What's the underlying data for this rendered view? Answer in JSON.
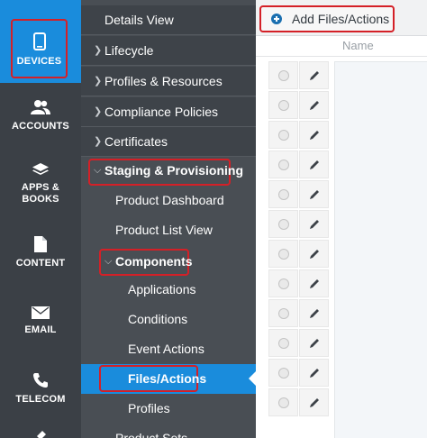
{
  "rail": {
    "items": [
      {
        "label": "DEVICES",
        "icon": "phone-icon"
      },
      {
        "label": "ACCOUNTS",
        "icon": "users-icon"
      },
      {
        "label_line1": "APPS &",
        "label_line2": "BOOKS",
        "icon": "layers-icon"
      },
      {
        "label": "CONTENT",
        "icon": "document-icon"
      },
      {
        "label": "EMAIL",
        "icon": "envelope-icon"
      },
      {
        "label": "TELECOM",
        "icon": "telephone-icon"
      }
    ],
    "active": "DEVICES"
  },
  "submenu": {
    "details_view": "Details View",
    "lifecycle": "Lifecycle",
    "profiles_resources": "Profiles & Resources",
    "compliance_policies": "Compliance Policies",
    "certificates": "Certificates",
    "staging_provisioning": "Staging & Provisioning",
    "product_dashboard": "Product Dashboard",
    "product_list_view": "Product List View",
    "components": "Components",
    "applications": "Applications",
    "conditions": "Conditions",
    "event_actions": "Event Actions",
    "files_actions": "Files/Actions",
    "profiles": "Profiles",
    "product_sets": "Product Sets"
  },
  "main": {
    "add_button": "Add Files/Actions",
    "column_name": "Name",
    "row_count": 12
  },
  "colors": {
    "accent": "#1a8cdc",
    "highlight": "#d42027",
    "rail_bg": "#3b4046",
    "submenu_bg": "#494e54"
  }
}
